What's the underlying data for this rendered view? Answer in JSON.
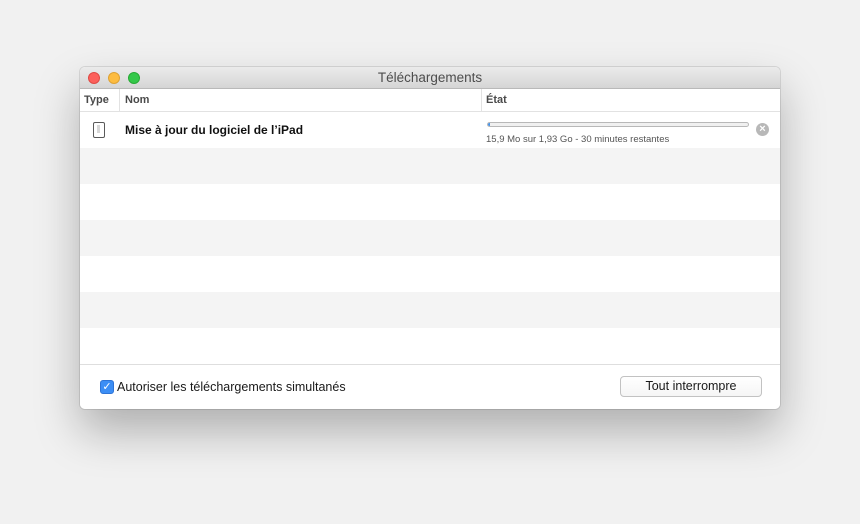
{
  "window": {
    "title": "Téléchargements"
  },
  "columns": {
    "type": "Type",
    "name": "Nom",
    "state": "État"
  },
  "download": {
    "icon": "ipad-icon",
    "name": "Mise à jour du logiciel de l’iPad",
    "progress_fraction": 0.008,
    "status": "15,9 Mo sur 1,93 Go - 30 minutes restantes",
    "stop_glyph": "×"
  },
  "footer": {
    "checkbox_checked": true,
    "checkbox_glyph": "✓",
    "checkbox_label": "Autoriser les téléchargements simultanés",
    "stop_all_label": "Tout interrompre"
  },
  "colors": {
    "accent": "#3c8ef5",
    "close": "#fc605b",
    "minimize": "#fdbc40",
    "maximize": "#34c84a"
  }
}
